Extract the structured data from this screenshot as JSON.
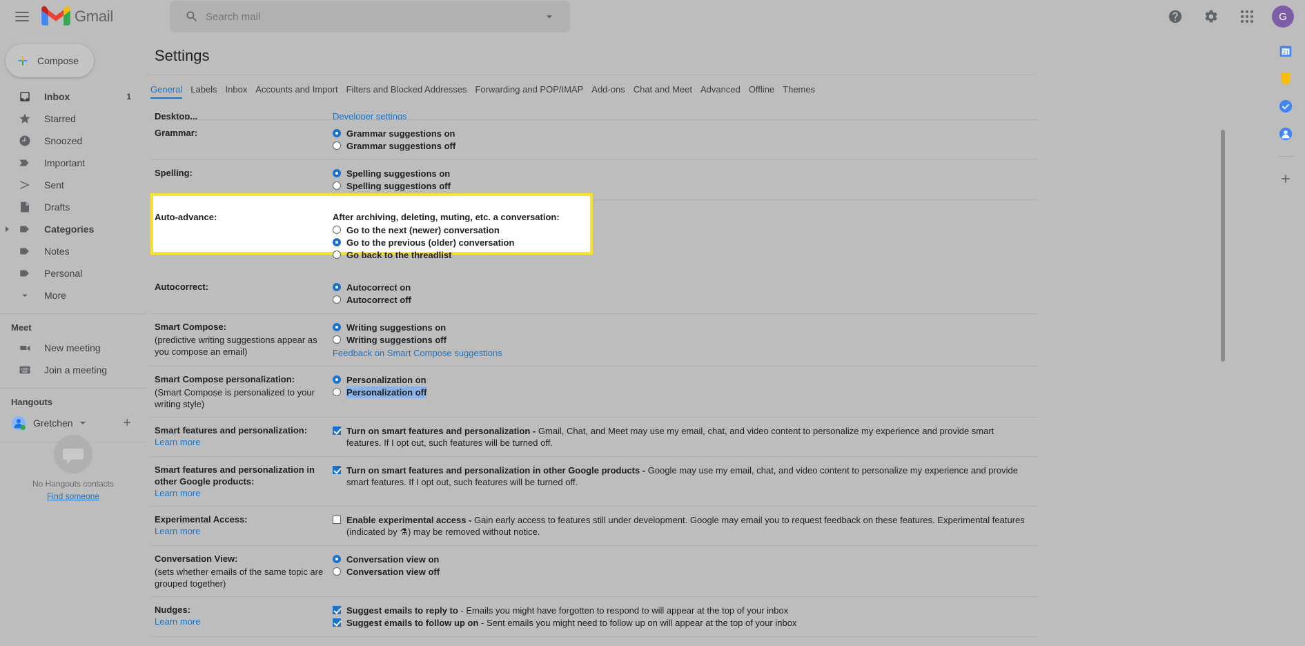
{
  "header": {
    "menu_icon": "hamburger-menu-icon",
    "brand": "Gmail",
    "search": {
      "placeholder": "Search mail",
      "value": "",
      "icon": "search-icon",
      "options_icon": "chevron-down-icon"
    },
    "help_icon": "help-icon",
    "settings_icon": "gear-icon",
    "apps_icon": "apps-grid-icon",
    "avatar_initial": "G",
    "avatar_color": "#7b5ea7"
  },
  "sidebar": {
    "compose": {
      "label": "Compose",
      "icon": "plus-icon"
    },
    "items": [
      {
        "label": "Inbox",
        "icon": "inbox-icon",
        "count": "1",
        "selected": true
      },
      {
        "label": "Starred",
        "icon": "star-icon",
        "count": ""
      },
      {
        "label": "Snoozed",
        "icon": "clock-icon",
        "count": ""
      },
      {
        "label": "Important",
        "icon": "important-icon",
        "count": ""
      },
      {
        "label": "Sent",
        "icon": "send-icon",
        "count": ""
      },
      {
        "label": "Drafts",
        "icon": "draft-icon",
        "count": ""
      },
      {
        "label": "Categories",
        "icon": "label-icon",
        "count": "",
        "expandable": true,
        "bold": true
      },
      {
        "label": "Notes",
        "icon": "label-icon",
        "count": ""
      },
      {
        "label": "Personal",
        "icon": "label-icon",
        "count": ""
      },
      {
        "label": "More",
        "icon": "chevron-down-icon",
        "count": ""
      }
    ],
    "meet": {
      "title": "Meet",
      "items": [
        {
          "label": "New meeting",
          "icon": "video-camera-icon"
        },
        {
          "label": "Join a meeting",
          "icon": "keyboard-icon"
        }
      ]
    },
    "hangouts": {
      "title": "Hangouts",
      "user": "Gretchen",
      "status": "online",
      "add_icon": "plus-icon",
      "empty_text": "No Hangouts contacts",
      "find_link": "Find someone"
    }
  },
  "settings": {
    "title": "Settings",
    "tabs": [
      {
        "label": "General",
        "active": true
      },
      {
        "label": "Labels",
        "active": false
      },
      {
        "label": "Inbox",
        "active": false
      },
      {
        "label": "Accounts and Import",
        "active": false
      },
      {
        "label": "Filters and Blocked Addresses",
        "active": false
      },
      {
        "label": "Forwarding and POP/IMAP",
        "active": false
      },
      {
        "label": "Add-ons",
        "active": false
      },
      {
        "label": "Chat and Meet",
        "active": false
      },
      {
        "label": "Advanced",
        "active": false
      },
      {
        "label": "Offline",
        "active": false
      },
      {
        "label": "Themes",
        "active": false
      }
    ],
    "clipped_top": {
      "left": "Desktop...",
      "right": "Developer settings"
    },
    "rows": {
      "grammar": {
        "label": "Grammar:",
        "options": [
          {
            "text": "Grammar suggestions on",
            "checked": true
          },
          {
            "text": "Grammar suggestions off",
            "checked": false
          }
        ]
      },
      "spelling": {
        "label": "Spelling:",
        "options": [
          {
            "text": "Spelling suggestions on",
            "checked": true
          },
          {
            "text": "Spelling suggestions off",
            "checked": false
          }
        ]
      },
      "auto_advance": {
        "label": "Auto-advance:",
        "heading": "After archiving, deleting, muting, etc. a conversation:",
        "options": [
          {
            "text": "Go to the next (newer) conversation",
            "checked": false
          },
          {
            "text": "Go to the previous (older) conversation",
            "checked": true
          },
          {
            "text": "Go back to the threadlist",
            "checked": false
          }
        ],
        "highlight_color": "#f7e230",
        "highlighted": true
      },
      "autocorrect": {
        "label": "Autocorrect:",
        "options": [
          {
            "text": "Autocorrect on",
            "checked": true
          },
          {
            "text": "Autocorrect off",
            "checked": false
          }
        ]
      },
      "smart_compose": {
        "label": "Smart Compose:",
        "sub": "(predictive writing suggestions appear as you compose an email)",
        "options": [
          {
            "text": "Writing suggestions on",
            "checked": true
          },
          {
            "text": "Writing suggestions off",
            "checked": false
          }
        ],
        "link": "Feedback on Smart Compose suggestions"
      },
      "smart_compose_personalization": {
        "label": "Smart Compose personalization:",
        "sub": "(Smart Compose is personalized to your writing style)",
        "options": [
          {
            "text": "Personalization on",
            "checked": true,
            "text_selected": false
          },
          {
            "text": "Personalization off",
            "checked": false,
            "text_selected": true
          }
        ]
      },
      "smart_features": {
        "label": "Smart features and personalization:",
        "learn_more": "Learn more",
        "checked": true,
        "bold_text": "Turn on smart features and personalization - ",
        "normal_text": "Gmail, Chat, and Meet may use my email, chat, and video content to personalize my experience and provide smart features. If I opt out, such features will be turned off."
      },
      "smart_features_other": {
        "label": "Smart features and personalization in other Google products:",
        "learn_more": "Learn more",
        "checked": true,
        "bold_text": "Turn on smart features and personalization in other Google products - ",
        "normal_text": "Google may use my email, chat, and video content to personalize my experience and provide smart features. If I opt out, such features will be turned off."
      },
      "experimental_access": {
        "label": "Experimental Access:",
        "learn_more": "Learn more",
        "checked": false,
        "bold_text": "Enable experimental access - ",
        "normal_text": "Gain early access to features still under development. Google may email you to request feedback on these features. Experimental features (indicated by ⚗) may be removed without notice."
      },
      "conversation_view": {
        "label": "Conversation View:",
        "sub": "(sets whether emails of the same topic are grouped together)",
        "options": [
          {
            "text": "Conversation view on",
            "checked": true
          },
          {
            "text": "Conversation view off",
            "checked": false
          }
        ]
      },
      "nudges": {
        "label": "Nudges:",
        "learn_more": "Learn more",
        "items": [
          {
            "checked": true,
            "bold_text": "Suggest emails to reply to",
            "normal_text": " - Emails you might have forgotten to respond to will appear at the top of your inbox"
          },
          {
            "checked": true,
            "bold_text": "Suggest emails to follow up on",
            "normal_text": " - Sent emails you might need to follow up on will appear at the top of your inbox"
          }
        ]
      }
    }
  },
  "right_rail": {
    "items": [
      {
        "icon": "calendar-icon"
      },
      {
        "icon": "keep-icon"
      },
      {
        "icon": "tasks-icon"
      },
      {
        "icon": "contacts-icon"
      },
      {
        "icon": "add-addon-icon"
      }
    ]
  }
}
